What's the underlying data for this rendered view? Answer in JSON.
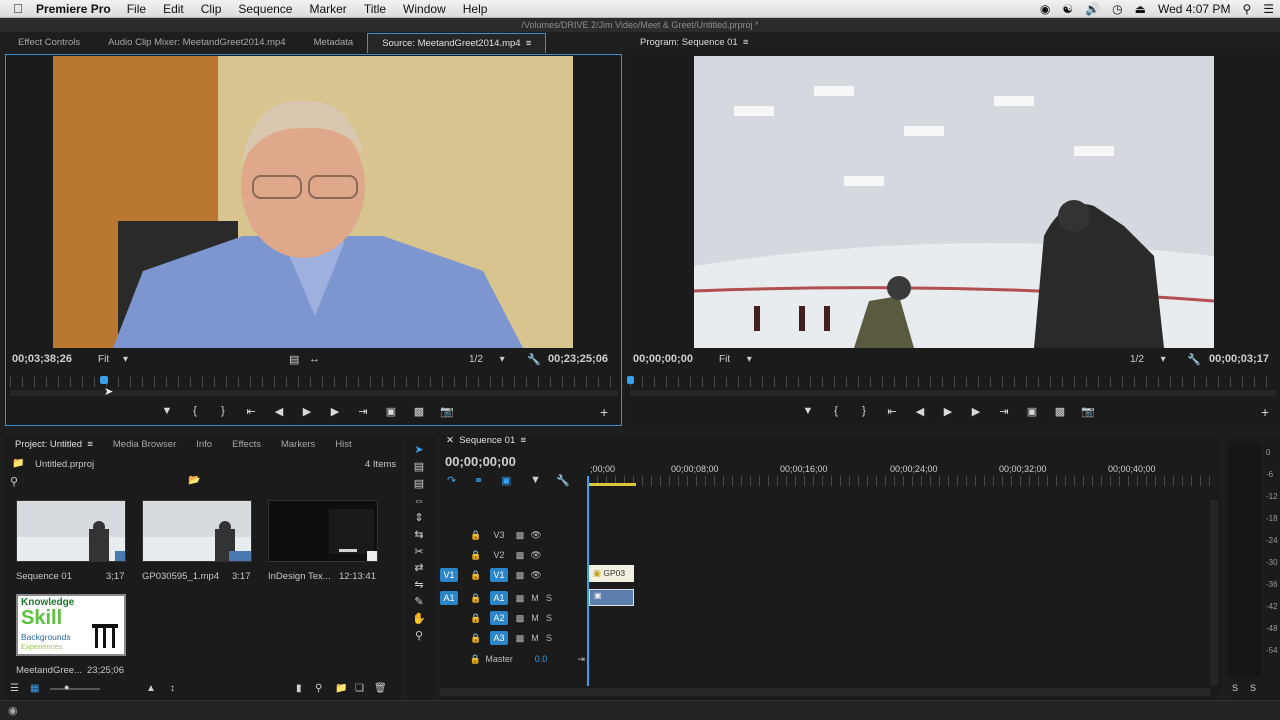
{
  "menubar": {
    "app": "Premiere Pro",
    "items": [
      "File",
      "Edit",
      "Clip",
      "Sequence",
      "Marker",
      "Title",
      "Window",
      "Help"
    ],
    "clock": "Wed 4:07 PM"
  },
  "window": {
    "path": "/Volumes/DRIVE 2/Jim Video/Meet & Greet/Untitled.prproj *"
  },
  "source_panel": {
    "tabs": [
      "Effect Controls",
      "Audio Clip Mixer: MeetandGreet2014.mp4",
      "Metadata",
      "Source: MeetandGreet2014.mp4"
    ],
    "timecode_current": "00;03;38;26",
    "zoom": "Fit",
    "resolution": "1/2",
    "timecode_duration": "00;23;25;06",
    "playhead_fraction": 0.155
  },
  "program_panel": {
    "tab": "Program: Sequence 01",
    "timecode_current": "00;00;00;00",
    "zoom": "Fit",
    "resolution": "1/2",
    "timecode_duration": "00;00;03;17"
  },
  "project_panel": {
    "tabs": [
      "Project: Untitled",
      "Media Browser",
      "Info",
      "Effects",
      "Markers",
      "Hist"
    ],
    "project_file": "Untitled.prproj",
    "item_count": "4 Items",
    "items": [
      {
        "name": "Sequence 01",
        "duration": "3;17"
      },
      {
        "name": "GP030595_1.mp4",
        "duration": "3:17"
      },
      {
        "name": "InDesign Tex...",
        "duration": "12:13:41"
      },
      {
        "name": "MeetandGree...",
        "duration": "23;25;06"
      }
    ],
    "logo_lines": [
      "Knowledge",
      "Skill",
      "Backgrounds",
      "Experiences"
    ]
  },
  "timeline": {
    "tab": "Sequence 01",
    "timecode": "00;00;00;00",
    "ruler_labels": [
      ";00;00",
      "00;00;08;00",
      "00;00;16;00",
      "00;00;24;00",
      "00;00;32;00",
      "00;00;40;00"
    ],
    "video_tracks": [
      {
        "source": "",
        "label": "V3"
      },
      {
        "source": "",
        "label": "V2"
      },
      {
        "source": "V1",
        "label": "V1"
      }
    ],
    "audio_tracks": [
      {
        "source": "A1",
        "label": "A1"
      },
      {
        "source": "",
        "label": "A2"
      },
      {
        "source": "",
        "label": "A3"
      }
    ],
    "master_label": "Master",
    "master_value": "0.0",
    "clip_label": "GP03"
  },
  "audio_meter": {
    "ticks": [
      "0",
      "-6",
      "-12",
      "-18",
      "-24",
      "-30",
      "-36",
      "-42",
      "-48",
      "-54"
    ],
    "solo_labels": [
      "S",
      "S"
    ]
  }
}
